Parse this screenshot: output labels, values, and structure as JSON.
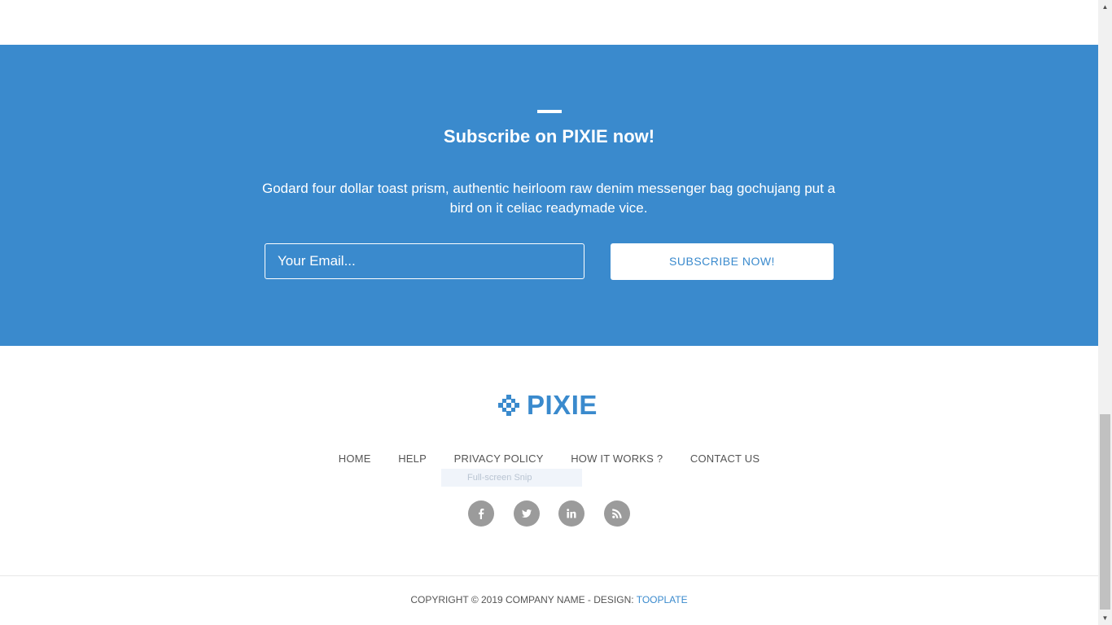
{
  "subscribe": {
    "title": "Subscribe on PIXIE now!",
    "description": "Godard four dollar toast prism, authentic heirloom raw denim messenger bag gochujang put a bird on it celiac readymade vice.",
    "email_placeholder": "Your Email...",
    "button_label": "SUBSCRIBE NOW!",
    "bg_color": "#3a8acd"
  },
  "footer": {
    "logo_text": "PIXIE",
    "logo_icon": "pixel-diamond-icon",
    "nav": [
      {
        "label": "HOME"
      },
      {
        "label": "HELP"
      },
      {
        "label": "PRIVACY POLICY"
      },
      {
        "label": "HOW IT WORKS ?"
      },
      {
        "label": "CONTACT US"
      }
    ],
    "tooltip": "Full-screen Snip",
    "social": [
      {
        "icon": "facebook-icon",
        "glyph": "f"
      },
      {
        "icon": "twitter-icon",
        "glyph": "t"
      },
      {
        "icon": "linkedin-icon",
        "glyph": "in"
      },
      {
        "icon": "rss-icon",
        "glyph": "rss"
      }
    ],
    "copyright_text": "COPYRIGHT © 2019 COMPANY NAME - DESIGN: ",
    "copyright_link": "TOOPLATE"
  },
  "colors": {
    "accent": "#3a8acd",
    "social_bg": "#9b9b9b",
    "nav_text": "#555555"
  }
}
